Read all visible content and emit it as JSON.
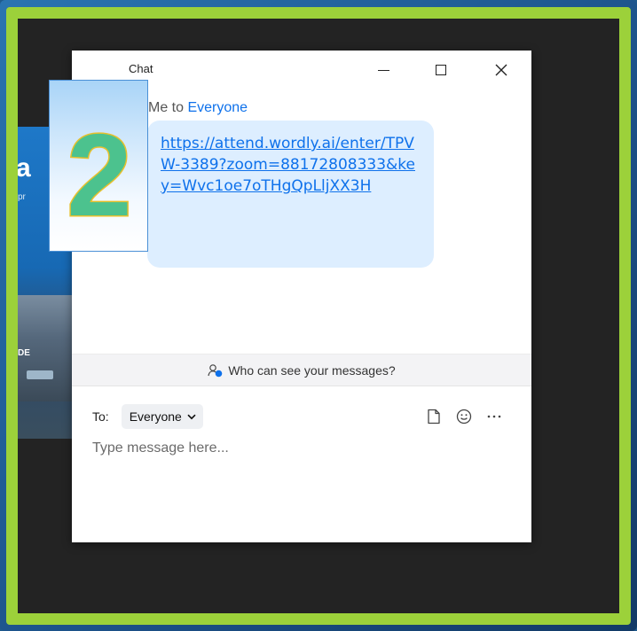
{
  "step_badge": {
    "number": "2"
  },
  "chat_window": {
    "title": "Chat",
    "controls": {
      "minimize": "minimize-icon",
      "maximize": "maximize-icon",
      "close": "close-icon"
    },
    "message": {
      "sender": "Me to",
      "recipient": "Everyone",
      "link_text": "https://attend.wordly.ai/enter/TPVW-3389?zoom=88172808333&key=Wvc1oe7oTHgQpLljXX3H"
    },
    "visibility_prompt": "Who can see your messages?",
    "composer": {
      "to_label": "To:",
      "selected_recipient": "Everyone",
      "placeholder": "Type message here...",
      "icons": [
        "file-icon",
        "emoji-icon",
        "more-icon"
      ]
    }
  },
  "background_app": {
    "visible_letter": "a",
    "visible_text": "pr",
    "train_text": "DE"
  },
  "colors": {
    "accent": "#0e71eb",
    "bubble": "#ddeeff",
    "border_green": "#9cd13a",
    "badge_number": "#4cc28e"
  }
}
